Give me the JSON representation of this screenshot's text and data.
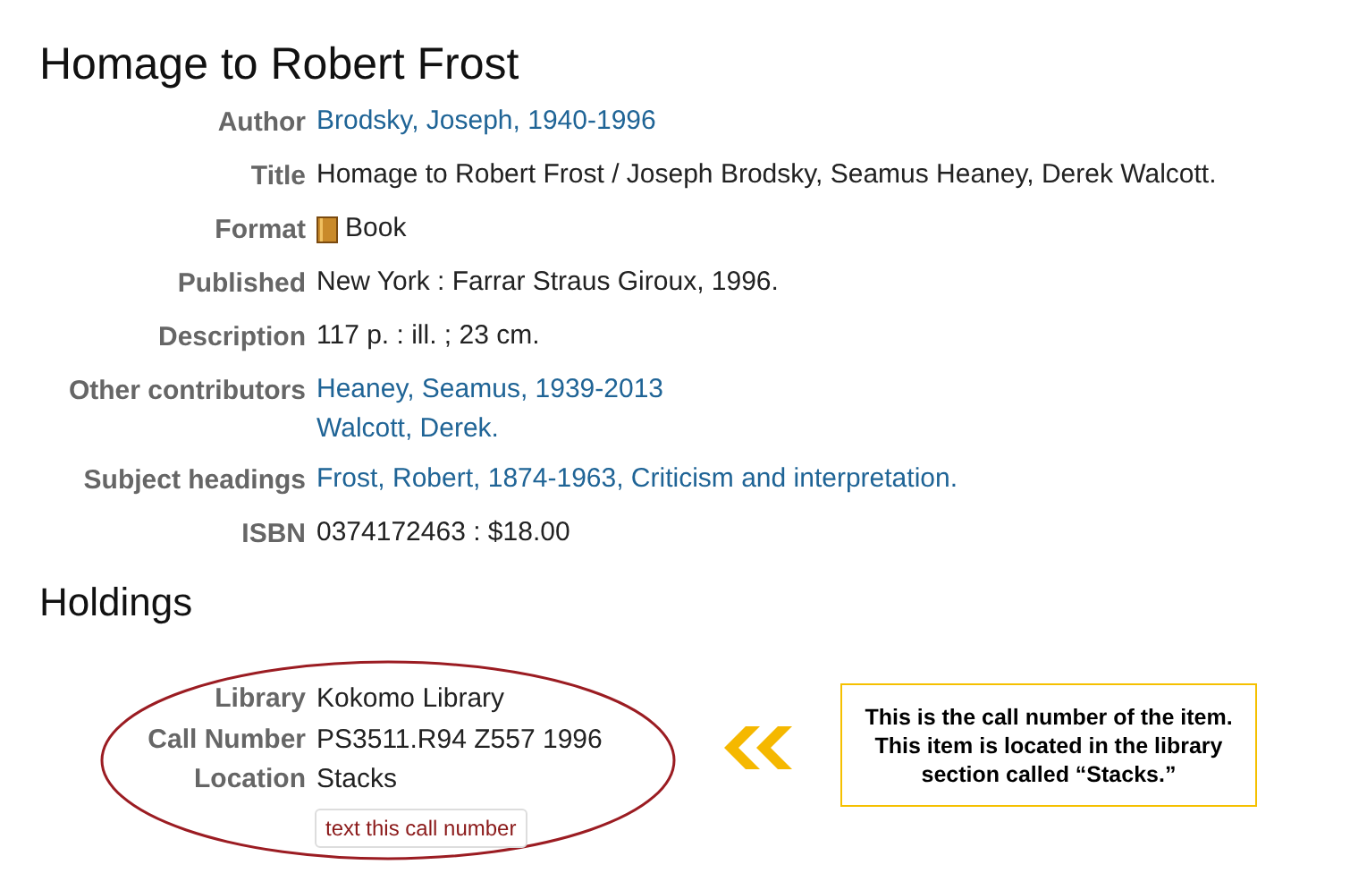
{
  "title": "Homage to Robert Frost",
  "details": [
    {
      "label": "Author",
      "kind": "links",
      "values": [
        "Brodsky, Joseph, 1940-1996"
      ]
    },
    {
      "label": "Title",
      "kind": "text",
      "values": [
        "Homage to Robert Frost / Joseph Brodsky, Seamus Heaney, Derek Walcott."
      ]
    },
    {
      "label": "Format",
      "kind": "format",
      "values": [
        "Book"
      ]
    },
    {
      "label": "Published",
      "kind": "text",
      "values": [
        "New York : Farrar Straus Giroux, 1996."
      ]
    },
    {
      "label": "Description",
      "kind": "text",
      "values": [
        "117 p. : ill. ; 23 cm."
      ]
    },
    {
      "label": "Other contributors",
      "kind": "links",
      "values": [
        "Heaney, Seamus, 1939-2013",
        "Walcott, Derek."
      ]
    },
    {
      "label": "Subject headings",
      "kind": "links",
      "values": [
        "Frost, Robert, 1874-1963, Criticism and interpretation."
      ]
    },
    {
      "label": "ISBN",
      "kind": "text",
      "values": [
        "0374172463 : $18.00"
      ]
    }
  ],
  "holdings": {
    "heading": "Holdings",
    "rows": [
      {
        "label": "Library",
        "value": "Kokomo Library"
      },
      {
        "label": "Call Number",
        "value": "PS3511.R94 Z557 1996"
      },
      {
        "label": "Location",
        "value": "Stacks"
      }
    ],
    "button": "text this call number"
  },
  "callout": "This is the call number of the item. This item is located in the library section called “Stacks.”"
}
